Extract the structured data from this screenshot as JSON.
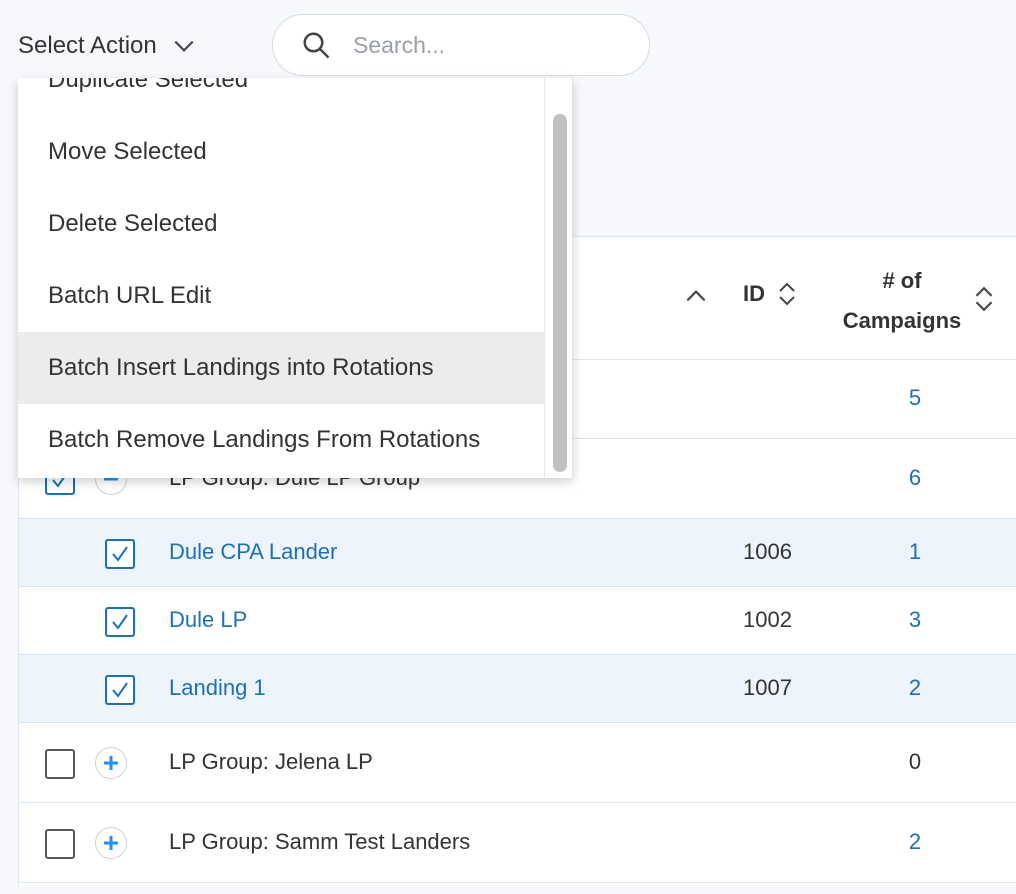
{
  "toolbar": {
    "select_action_label": "Select Action",
    "search_placeholder": "Search..."
  },
  "dropdown": {
    "items": [
      "Duplicate Selected",
      "Move Selected",
      "Delete Selected",
      "Batch URL Edit",
      "Batch Insert Landings into Rotations",
      "Batch Remove Landings From Rotations"
    ],
    "highlighted_item": "Batch Insert Landings into Rotations"
  },
  "table": {
    "headers": {
      "id": "ID",
      "campaigns_line1": "# of",
      "campaigns_line2": "Campaigns"
    },
    "rows": [
      {
        "name": "",
        "id": "",
        "campaigns": "5",
        "checked": null
      },
      {
        "name": "LP Group: Dule LP Group",
        "id": "",
        "campaigns": "6",
        "checked": true,
        "expanded": true
      },
      {
        "name": "Dule CPA Lander",
        "id": "1006",
        "campaigns": "1",
        "checked": true
      },
      {
        "name": "Dule LP",
        "id": "1002",
        "campaigns": "3",
        "checked": true
      },
      {
        "name": "Landing 1",
        "id": "1007",
        "campaigns": "2",
        "checked": true
      },
      {
        "name": "LP Group: Jelena LP",
        "id": "",
        "campaigns": "0",
        "checked": false,
        "expanded": false
      },
      {
        "name": "LP Group: Samm Test Landers",
        "id": "",
        "campaigns": "2",
        "checked": false,
        "expanded": false
      }
    ]
  },
  "colors": {
    "link": "#1e6fb4",
    "row_alt": "#eef4fb",
    "page_bg": "#f6f8fc",
    "hover": "#ececec"
  }
}
